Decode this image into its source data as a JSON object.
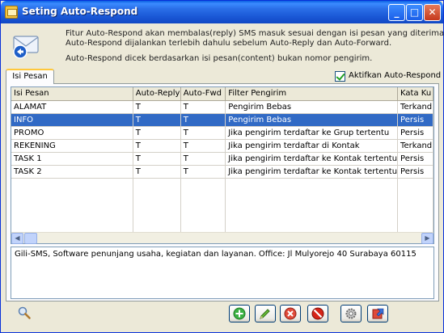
{
  "window": {
    "title": "Seting Auto-Respond"
  },
  "intro": {
    "line1": "Fitur Auto-Respond akan membalas(reply) SMS masuk sesuai dengan isi pesan yang diterima.",
    "line2": "Auto-Respond dijalankan terlebih dahulu sebelum Auto-Reply dan Auto-Forward.",
    "line3": "Auto-Respond dicek berdasarkan isi pesan(content) bukan nomor pengirim."
  },
  "tabs": {
    "active": "Isi Pesan"
  },
  "checkbox": {
    "label": "Aktifkan Auto-Respond",
    "checked": true
  },
  "table": {
    "columns": [
      "Isi Pesan",
      "Auto-Reply",
      "Auto-Fwd",
      "Filter Pengirim",
      "Kata Ku"
    ],
    "rows": [
      {
        "isi": "ALAMAT",
        "reply": "T",
        "fwd": "T",
        "filter": "Pengirim Bebas",
        "kata": "Terkand"
      },
      {
        "isi": "INFO",
        "reply": "T",
        "fwd": "T",
        "filter": "Pengirim Bebas",
        "kata": "Persis"
      },
      {
        "isi": "PROMO",
        "reply": "T",
        "fwd": "T",
        "filter": "Jika pengirim terdaftar ke Grup tertentu",
        "kata": "Persis"
      },
      {
        "isi": "REKENING",
        "reply": "T",
        "fwd": "T",
        "filter": "Jika pengirim terdaftar di Kontak",
        "kata": "Terkand"
      },
      {
        "isi": "TASK 1",
        "reply": "T",
        "fwd": "T",
        "filter": "Jika pengirim terdaftar ke Kontak tertentu",
        "kata": "Persis"
      },
      {
        "isi": "TASK 2",
        "reply": "T",
        "fwd": "T",
        "filter": "Jika pengirim terdaftar ke Kontak tertentu",
        "kata": "Persis"
      }
    ],
    "selected_row": "INFO"
  },
  "footer": {
    "text": "Gili-SMS, Software penunjang usaha, kegiatan dan layanan. Office: Jl Mulyorejo 40 Surabaya 60115"
  },
  "colors": {
    "selection": "#316ac5",
    "titlebar": "#1a58d6",
    "window_bg": "#ece9d8"
  },
  "icons": [
    "mail-back-icon",
    "search-icon",
    "add-icon",
    "edit-icon",
    "delete-icon",
    "stop-icon",
    "settings-icon",
    "exit-icon"
  ]
}
